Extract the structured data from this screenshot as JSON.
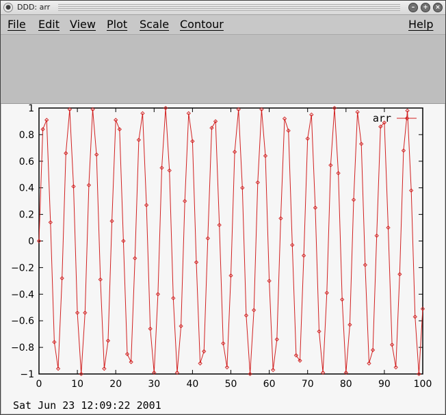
{
  "window": {
    "title": "DDD: arr"
  },
  "menubar": {
    "items": [
      "File",
      "Edit",
      "View",
      "Plot",
      "Scale",
      "Contour"
    ],
    "help": "Help"
  },
  "timestamp": "Sat Jun 23 12:09:22 2001",
  "colors": {
    "series": "#d11f1f",
    "plot_bg": "#f6f6f6",
    "window_bg": "#c0c0c0"
  },
  "chart_data": {
    "type": "line",
    "xlim": [
      0,
      100
    ],
    "ylim": [
      -1,
      1
    ],
    "xticks": [
      0,
      10,
      20,
      30,
      40,
      50,
      60,
      70,
      80,
      90,
      100
    ],
    "yticks": [
      -1,
      -0.8,
      -0.6,
      -0.4,
      -0.2,
      0,
      0.2,
      0.4,
      0.6,
      0.8,
      1
    ],
    "legend_position": "top-right",
    "grid": false,
    "series": [
      {
        "name": "arr",
        "x": [
          0,
          1,
          2,
          3,
          4,
          5,
          6,
          7,
          8,
          9,
          10,
          11,
          12,
          13,
          14,
          15,
          16,
          17,
          18,
          19,
          20,
          21,
          22,
          23,
          24,
          25,
          26,
          27,
          28,
          29,
          30,
          31,
          32,
          33,
          34,
          35,
          36,
          37,
          38,
          39,
          40,
          41,
          42,
          43,
          44,
          45,
          46,
          47,
          48,
          49,
          50,
          51,
          52,
          53,
          54,
          55,
          56,
          57,
          58,
          59,
          60,
          61,
          62,
          63,
          64,
          65,
          66,
          67,
          68,
          69,
          70,
          71,
          72,
          73,
          74,
          75,
          76,
          77,
          78,
          79,
          80,
          81,
          82,
          83,
          84,
          85,
          86,
          87,
          88,
          89,
          90,
          91,
          92,
          93,
          94,
          95,
          96,
          97,
          98,
          99,
          100
        ],
        "values": [
          0,
          0.84,
          0.91,
          0.14,
          -0.76,
          -0.96,
          -0.28,
          0.66,
          0.99,
          0.41,
          -0.54,
          -1,
          -0.54,
          0.42,
          0.99,
          0.65,
          -0.29,
          -0.96,
          -0.75,
          0.15,
          0.91,
          0.84,
          0,
          -0.85,
          -0.91,
          -0.13,
          0.76,
          0.96,
          0.27,
          -0.66,
          -0.99,
          -0.4,
          0.55,
          1,
          0.53,
          -0.43,
          -0.99,
          -0.64,
          0.3,
          0.96,
          0.75,
          -0.16,
          -0.92,
          -0.83,
          0.02,
          0.85,
          0.9,
          0.12,
          -0.77,
          -0.95,
          -0.26,
          0.67,
          0.99,
          0.4,
          -0.56,
          -1,
          -0.52,
          0.44,
          0.99,
          0.64,
          -0.3,
          -0.97,
          -0.74,
          0.17,
          0.92,
          0.83,
          -0.03,
          -0.86,
          -0.9,
          -0.11,
          0.77,
          0.95,
          0.25,
          -0.68,
          -0.99,
          -0.39,
          0.57,
          1,
          0.51,
          -0.44,
          -0.99,
          -0.63,
          0.31,
          0.97,
          0.73,
          -0.18,
          -0.92,
          -0.82,
          0.04,
          0.86,
          0.89,
          0.1,
          -0.78,
          -0.95,
          -0.25,
          0.68,
          0.98,
          0.38,
          -0.57,
          -1,
          -0.51
        ]
      }
    ]
  }
}
